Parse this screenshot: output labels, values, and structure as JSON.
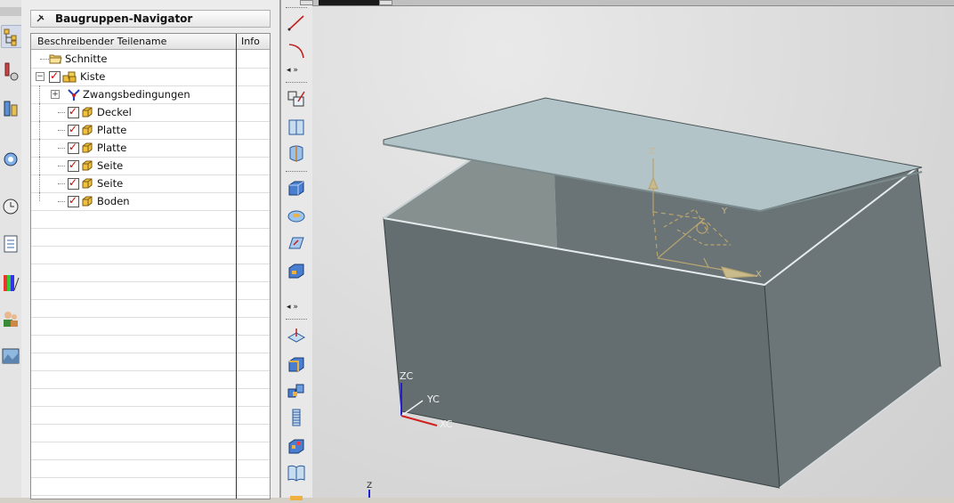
{
  "navigator": {
    "title": "Baugruppen-Navigator",
    "columns": [
      "Beschreibender Teilename",
      "Info"
    ],
    "rows": [
      {
        "label": "Schnitte",
        "type": "folder"
      },
      {
        "label": "Kiste",
        "type": "assembly",
        "checked": true
      },
      {
        "label": "Zwangsbedingungen",
        "type": "constraints"
      },
      {
        "label": "Deckel",
        "type": "part",
        "checked": true
      },
      {
        "label": "Platte",
        "type": "part",
        "checked": true
      },
      {
        "label": "Platte",
        "type": "part",
        "checked": true
      },
      {
        "label": "Seite",
        "type": "part",
        "checked": true
      },
      {
        "label": "Seite",
        "type": "part",
        "checked": true
      },
      {
        "label": "Boden",
        "type": "part",
        "checked": true
      }
    ]
  },
  "resource_bar": {
    "icons": [
      "assembly-navigator-icon",
      "constraint-navigator-icon",
      "part-navigator-icon",
      "reuse-library-icon",
      "history-icon",
      "process-studio-icon",
      "visualization-icon",
      "roles-icon",
      "system-scenes-icon"
    ]
  },
  "toolbar": {
    "icons": [
      "line-icon",
      "arc-icon",
      "sketch-icon",
      "datum-plane-icon",
      "datum-axis-icon",
      "block-icon",
      "cylinder-icon",
      "edge-blend-icon",
      "shell-icon",
      "extrude-icon",
      "cut-icon",
      "pattern-icon",
      "thread-icon",
      "assembly-icon",
      "book-icon"
    ]
  },
  "viewport": {
    "wcs_labels": {
      "zc": "ZC",
      "yc": "YC",
      "xc": "XC"
    },
    "csys_labels": {
      "z": "Z",
      "x": "X",
      "y": "Y"
    },
    "bottom_axis_label": "Z",
    "colors": {
      "box_face": "#646e70",
      "box_side": "#6c7577",
      "lid": "#b3c4c8",
      "inner": "#86918f",
      "csys": "#b8a470",
      "zc": "#2020d0",
      "xc": "#d02020"
    }
  }
}
